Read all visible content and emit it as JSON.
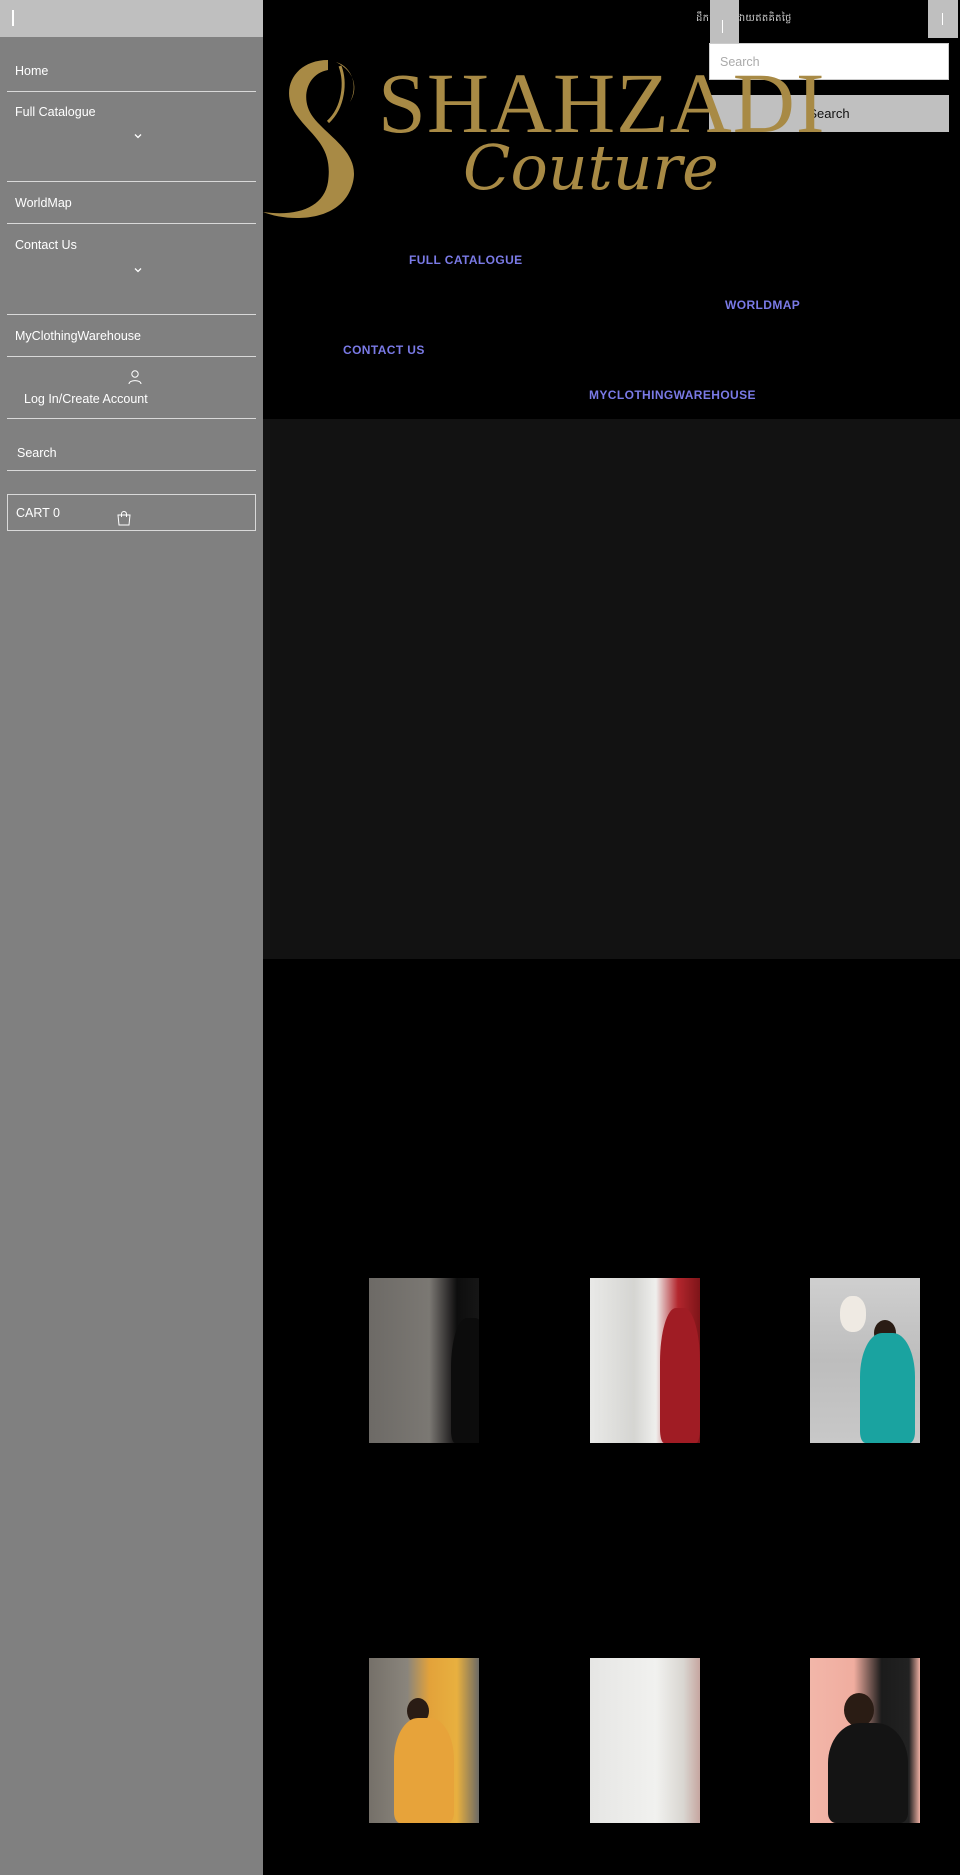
{
  "drawer": {
    "items": [
      {
        "label": "Home"
      },
      {
        "label": "Full Catalogue"
      },
      {
        "label": "WorldMap"
      },
      {
        "label": "Contact Us"
      },
      {
        "label": "MyClothingWarehouse"
      }
    ],
    "login_label": "Log In/Create Account",
    "search_label": "Search",
    "cart_label": "CART 0"
  },
  "header": {
    "announcement": "ដឹកជញ្ជូនដោយឥតគិតថ្លៃ",
    "search_placeholder": "Search",
    "search_button": "Search",
    "logo_main": "SHAHZADI",
    "logo_sub": "Couture",
    "logo_color": "#a88a45"
  },
  "nav": {
    "links": [
      {
        "label": "FULL CATALOGUE"
      },
      {
        "label": "WORLDMAP"
      },
      {
        "label": "CONTACT US"
      },
      {
        "label": "MYCLOTHINGWAREHOUSE"
      }
    ],
    "link_color": "#7a7ae6"
  },
  "icons": {
    "chevron": "chevron-down-icon",
    "user": "user-icon",
    "bag": "shopping-bag-icon"
  }
}
